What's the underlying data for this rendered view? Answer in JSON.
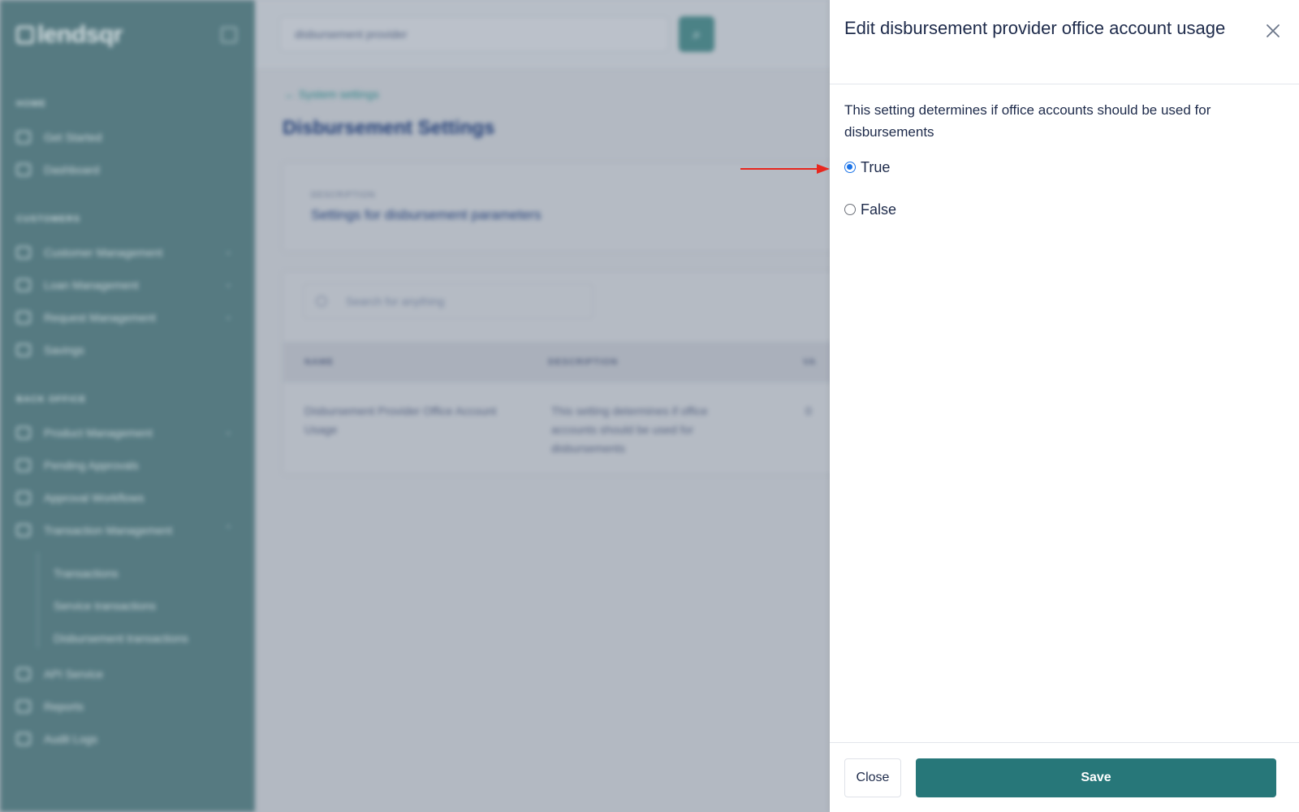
{
  "app": {
    "logo_text": "lendsqr",
    "top_search": {
      "value": "disbursement provider"
    }
  },
  "sidebar": {
    "sections": [
      {
        "label": "HOME"
      },
      {
        "label": "CUSTOMERS"
      },
      {
        "label": "BACK OFFICE"
      }
    ],
    "items": [
      {
        "label": "Get Started",
        "icon": "home-icon"
      },
      {
        "label": "Dashboard",
        "icon": "dashboard-icon"
      },
      {
        "label": "Customer Management",
        "icon": "users-icon",
        "chevron": "⌄"
      },
      {
        "label": "Loan Management",
        "icon": "user-loan-icon",
        "chevron": "⌄"
      },
      {
        "label": "Request Management",
        "icon": "chart-icon",
        "chevron": "⌄"
      },
      {
        "label": "Savings",
        "icon": "piggy-bank-icon"
      },
      {
        "label": "Product Management",
        "icon": "product-icon",
        "chevron": "⌄"
      },
      {
        "label": "Pending Approvals",
        "icon": "clock-icon"
      },
      {
        "label": "Approval Workflows",
        "icon": "workflow-icon"
      },
      {
        "label": "Transaction Management",
        "icon": "transaction-icon",
        "chevron": "⌃"
      },
      {
        "label": "API Service",
        "icon": "api-icon"
      },
      {
        "label": "Reports",
        "icon": "reports-icon"
      },
      {
        "label": "Audit Logs",
        "icon": "audit-icon"
      }
    ],
    "sub_items": [
      {
        "label": "Transactions"
      },
      {
        "label": "Service transactions"
      },
      {
        "label": "Disbursement transactions"
      }
    ]
  },
  "main": {
    "back_link": "System settings",
    "page_title": "Disbursement Settings",
    "description_label": "DESCRIPTION",
    "description_value": "Settings for disbursement parameters",
    "table_search_placeholder": "Search for anything",
    "table": {
      "headers": [
        "NAME",
        "DESCRIPTION",
        "VA"
      ],
      "rows": [
        [
          "Disbursement Provider Office Account Usage",
          "This setting determines if office accounts should be used for disbursements",
          "0"
        ]
      ]
    }
  },
  "drawer": {
    "title": "Edit disbursement provider office account usage",
    "description": "This setting determines if office accounts should be used for disbursements",
    "options": [
      {
        "label": "True",
        "checked": true
      },
      {
        "label": "False",
        "checked": false
      }
    ],
    "close_label": "Close",
    "save_label": "Save"
  },
  "colors": {
    "sidebar": "#5a8187",
    "primary": "#277779",
    "radio_checked": "#1a73e8",
    "annotation_arrow": "#e8271e"
  }
}
